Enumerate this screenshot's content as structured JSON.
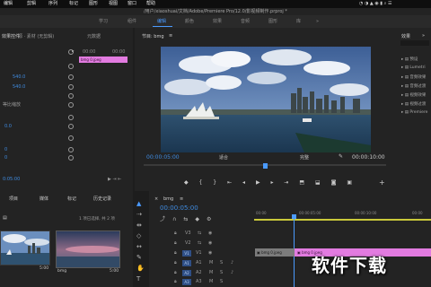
{
  "menubar": {
    "items": [
      "编辑",
      "剪辑",
      "序列",
      "标记",
      "图形",
      "视图",
      "窗口",
      "帮助"
    ],
    "right_icons": [
      "tray-icons"
    ]
  },
  "pathbar": {
    "path": "/用户/xiaoshuai/文档/Adobe/Premiere Pro/12.0/影视频制作.prproj *"
  },
  "workspace": {
    "tabs": [
      "学习",
      "组件",
      "编辑",
      "颜色",
      "效果",
      "音频",
      "图形",
      "库"
    ],
    "active": "编辑"
  },
  "effect_controls": {
    "title": "效果控件",
    "source_label": "源 · 素材 (无剪辑)",
    "metadata_tab": "元数据",
    "timecodes": [
      "00:00",
      "00:00"
    ],
    "clip_name": "bmg 0.jpeg",
    "rows": [
      {
        "label": "",
        "value": ""
      },
      {
        "label": "",
        "value": "540.0"
      },
      {
        "label": "",
        "value": "540.0"
      },
      {
        "label": "",
        "value": ""
      },
      {
        "label": "等比缩放",
        "value": ""
      },
      {
        "label": "",
        "value": "0.0"
      },
      {
        "label": "",
        "value": "0"
      },
      {
        "label": "",
        "value": "0"
      }
    ],
    "footer_timecode": "0:05:00"
  },
  "program": {
    "title": "节目: bmg",
    "timecode_left": "00:00:05:00",
    "fit_label": "适合",
    "full_label": "完整",
    "timecode_right": "00:00:10:00",
    "playhead_fraction": 0.5
  },
  "effects": {
    "title": "效果",
    "items": [
      "预设",
      "Lumetri",
      "音频效果",
      "音频过渡",
      "视频效果",
      "视频过渡",
      "Premiere"
    ]
  },
  "project": {
    "tabs": [
      "项目",
      "媒体",
      "标记",
      "历史记录"
    ],
    "info": "1 项已选择, 共 2 项",
    "clips": [
      {
        "name": "bmg",
        "duration": "5:00"
      },
      {
        "name": "bmg",
        "duration": "5:00"
      }
    ]
  },
  "timeline": {
    "title": "bmg",
    "timecode": "00:00:05:00",
    "ruler": [
      "00:00",
      "00:00:05:00",
      "00:00:10:00",
      "00:00"
    ],
    "tracks": [
      "V3",
      "V2",
      "V1",
      "A1",
      "A2",
      "A3"
    ],
    "clip_label": "bmg 0.jpeg",
    "buttons": [
      "M",
      "S"
    ]
  },
  "watermark": "软件下载"
}
